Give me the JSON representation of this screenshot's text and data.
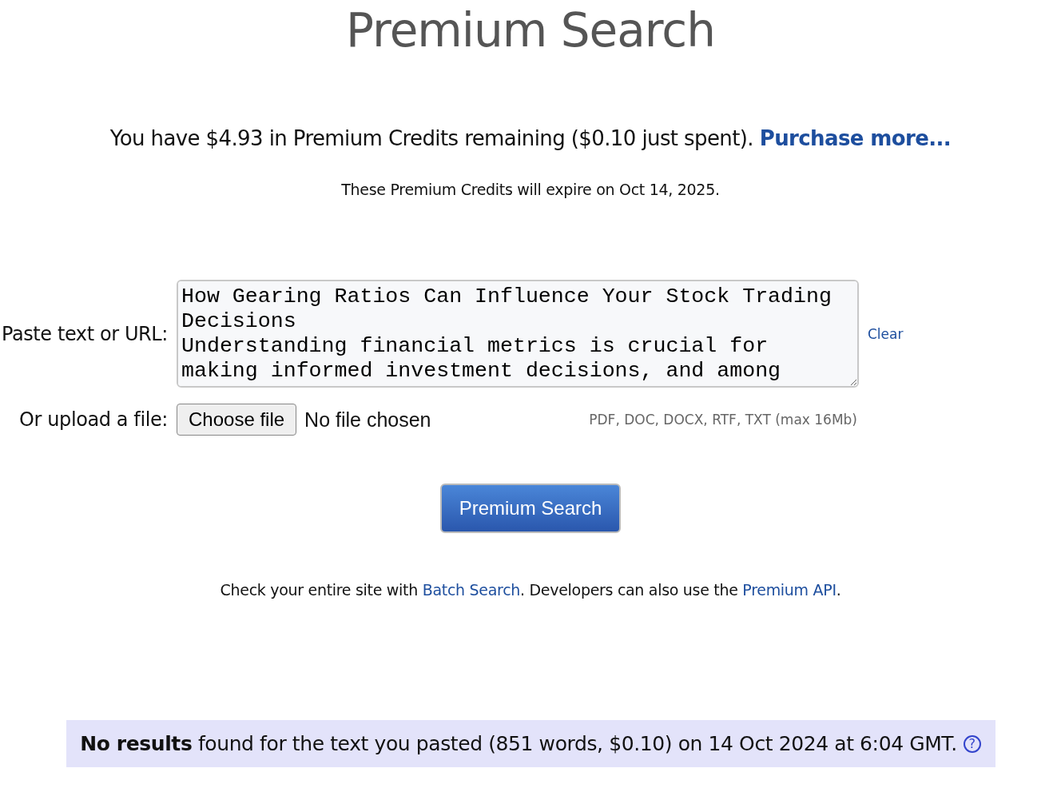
{
  "title": "Premium Search",
  "credits": {
    "text": "You have $4.93 in Premium Credits remaining ($0.10 just spent).",
    "link": "Purchase more..."
  },
  "expiry": "These Premium Credits will expire on Oct 14, 2025.",
  "paste": {
    "label": "Paste text or URL:",
    "value": "How Gearing Ratios Can Influence Your Stock Trading Decisions\nUnderstanding financial metrics is crucial for making informed investment decisions, and among",
    "clear": "Clear"
  },
  "upload": {
    "label": "Or upload a file:",
    "button": "Choose file",
    "status": "No file chosen",
    "hint": "PDF, DOC, DOCX, RTF, TXT (max 16Mb)"
  },
  "search_button": "Premium Search",
  "note": [
    {
      "kind": "text",
      "text": "Check your entire site with"
    },
    {
      "kind": "link",
      "text": "Batch Search"
    },
    {
      "kind": "text",
      "text": ". Developers can also use the"
    },
    {
      "kind": "link",
      "text": "Premium API"
    },
    {
      "kind": "text",
      "text": "."
    }
  ],
  "result": {
    "text": "**No results** found for the text you pasted (851 words, $0.10) on 14 Oct 2024 at 6:04 GMT.",
    "help": "?"
  }
}
